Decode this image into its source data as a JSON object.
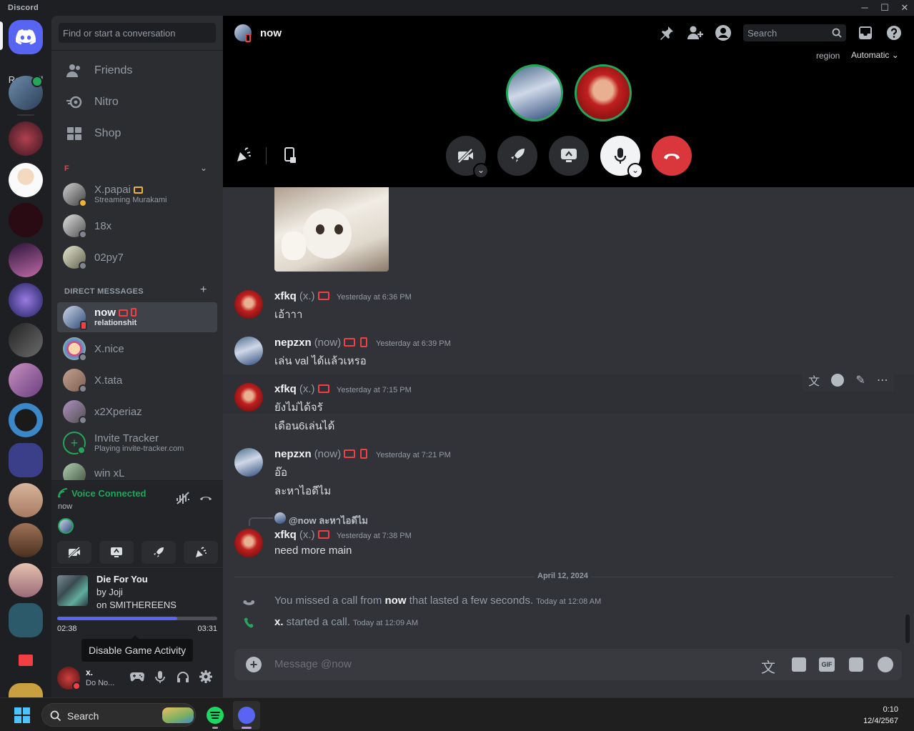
{
  "window": {
    "app_name": "Discord"
  },
  "rail": {
    "read_all": "Read All"
  },
  "sidebar": {
    "search_placeholder": "Find or start a conversation",
    "nav": [
      {
        "label": "Friends"
      },
      {
        "label": "Nitro"
      },
      {
        "label": "Shop"
      }
    ],
    "group_header": "F",
    "group_items": [
      {
        "name": "X.papai",
        "sub": "Streaming Murakami"
      },
      {
        "name": "18x",
        "sub": ""
      },
      {
        "name": "02py7",
        "sub": ""
      }
    ],
    "dm_header": "DIRECT MESSAGES",
    "dms": [
      {
        "name": "now",
        "sub": "relationshit"
      },
      {
        "name": "X.nice",
        "sub": ""
      },
      {
        "name": "X.tata",
        "sub": ""
      },
      {
        "name": "x2Xperiaz",
        "sub": ""
      },
      {
        "name": "Invite Tracker",
        "sub": "Playing invite-tracker.com"
      },
      {
        "name": "win xL",
        "sub": ""
      }
    ]
  },
  "voice": {
    "title": "Voice Connected",
    "channel": "now"
  },
  "music": {
    "title": "Die For You",
    "artist": "by Joji",
    "album": "on SMITHEREENS",
    "elapsed": "02:38",
    "total": "03:31",
    "progress": 0.75
  },
  "tooltip": "Disable Game Activity",
  "user": {
    "name": "x.",
    "status": "Do No..."
  },
  "call": {
    "title": "now",
    "search_placeholder": "Search",
    "region_label": "region",
    "region_value": "Automatic"
  },
  "messages": [
    {
      "author": "xfkq",
      "tag": "(x.)",
      "time": "Yesterday at 6:36 PM",
      "lines": [
        "เอ้าาา"
      ]
    },
    {
      "author": "nepzxn",
      "tag": "(now)",
      "time": "Yesterday at 6:39 PM",
      "lines": [
        "เล่น val ได้แล้วเหรอ"
      ]
    },
    {
      "author": "xfkq",
      "tag": "(x.)",
      "time": "Yesterday at 7:15 PM",
      "lines": [
        "ยังไม่ได้จรั",
        "เดือน6เล่นได้"
      ]
    },
    {
      "author": "nepzxn",
      "tag": "(now)",
      "time": "Yesterday at 7:21 PM",
      "lines": [
        "อ๊อ",
        "ละหาไอดีไม"
      ]
    },
    {
      "author": "xfkq",
      "tag": "(x.)",
      "time": "Yesterday at 7:38 PM",
      "lines": [
        "need more main"
      ],
      "reply": "@now ละหาไอดีไม"
    }
  ],
  "date_divider": "April 12, 2024",
  "system": [
    {
      "pre": "You missed a call from ",
      "bold": "now",
      "post": " that lasted a few seconds.",
      "time": "Today at 12:08 AM"
    },
    {
      "pre": "",
      "bold": "x.",
      "post": " started a call.",
      "time": "Today at 12:09 AM"
    }
  ],
  "composer": {
    "placeholder": "Message @now"
  },
  "taskbar": {
    "search": "Search",
    "time": "0:10",
    "date": "12/4/2567"
  },
  "colors": {
    "accent": "#5865f2",
    "online": "#23a55a",
    "dnd": "#f23f43",
    "idle": "#f0b232"
  }
}
